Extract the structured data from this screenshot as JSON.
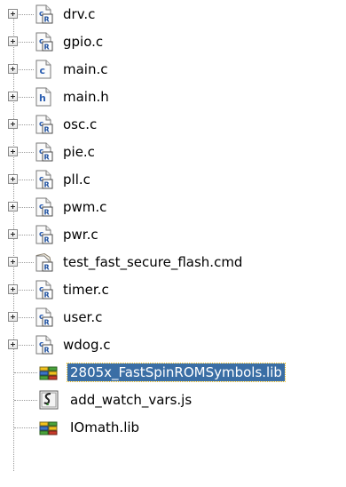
{
  "tree": {
    "items": [
      {
        "label": "drv.c",
        "icon": "source-file-icon",
        "expandable": true
      },
      {
        "label": "gpio.c",
        "icon": "source-file-icon",
        "expandable": true
      },
      {
        "label": "main.c",
        "icon": "c-file-icon",
        "expandable": true
      },
      {
        "label": "main.h",
        "icon": "header-file-icon",
        "expandable": true
      },
      {
        "label": "osc.c",
        "icon": "source-file-icon",
        "expandable": true
      },
      {
        "label": "pie.c",
        "icon": "source-file-icon",
        "expandable": true
      },
      {
        "label": "pll.c",
        "icon": "source-file-icon",
        "expandable": true
      },
      {
        "label": "pwm.c",
        "icon": "source-file-icon",
        "expandable": true
      },
      {
        "label": "pwr.c",
        "icon": "source-file-icon",
        "expandable": true
      },
      {
        "label": "test_fast_secure_flash.cmd",
        "icon": "linker-cmd-file-icon",
        "expandable": true
      },
      {
        "label": "timer.c",
        "icon": "source-file-icon",
        "expandable": true
      },
      {
        "label": "user.c",
        "icon": "source-file-icon",
        "expandable": true
      },
      {
        "label": "wdog.c",
        "icon": "source-file-icon",
        "expandable": true
      },
      {
        "label": "2805x_FastSpinROMSymbols.lib",
        "icon": "library-file-icon",
        "expandable": false,
        "selected": true
      },
      {
        "label": "add_watch_vars.js",
        "icon": "script-file-icon",
        "expandable": false
      },
      {
        "label": "IOmath.lib",
        "icon": "library-file-icon",
        "expandable": false
      }
    ]
  },
  "colors": {
    "selection_bg": "#3a6ea5",
    "selection_text": "#ffffff"
  }
}
